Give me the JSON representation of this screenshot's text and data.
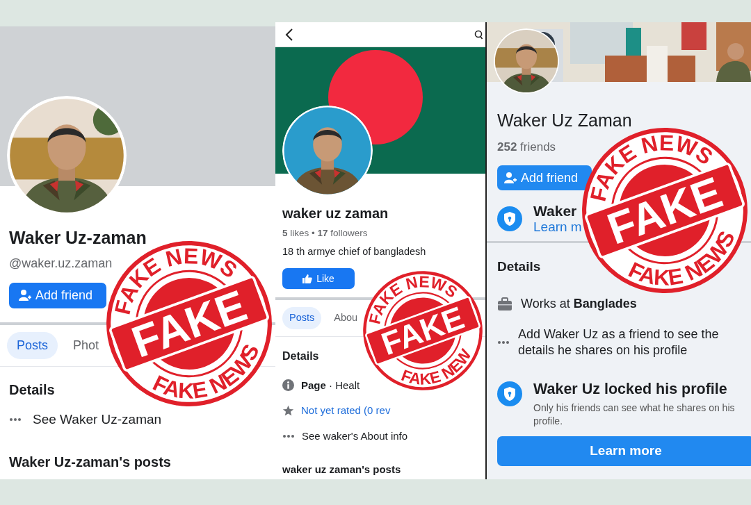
{
  "screenshots": [
    {
      "kind": "profile_grey",
      "name": "Waker Uz-zaman",
      "handle": "@waker.uz.zaman",
      "add_friend": "Add friend",
      "tabs": [
        {
          "label": "Posts",
          "selected": true
        },
        {
          "label": "Phot",
          "selected": false
        }
      ],
      "details_title": "Details",
      "details": [
        {
          "kind": "more",
          "text": "See Waker Uz-zaman"
        }
      ],
      "posts_title": "Waker Uz-zaman's posts",
      "stamp": {
        "top": "FAKE NEWS",
        "middle": "FAKE",
        "bottom": "FAKE NEWS"
      }
    },
    {
      "kind": "page_flag",
      "name": "waker uz zaman",
      "stats": "**5** likes  •  **17** followers",
      "bio": "18 th armye chief of bangladesh",
      "like": "Like",
      "tabs": [
        {
          "label": "Posts",
          "selected": true
        },
        {
          "label": "Abou",
          "selected": false
        }
      ],
      "details_title": "Details",
      "details": [
        {
          "kind": "info",
          "text": "**Page** · Healt"
        },
        {
          "kind": "star",
          "text": "Not yet rated (0 rev"
        },
        {
          "kind": "more",
          "text": "See waker's About info"
        }
      ],
      "posts_title": "waker uz zaman's posts",
      "stamp": {
        "top": "FAKE NEWS",
        "middle": "FAKE",
        "bottom": "FAKE NEW"
      }
    },
    {
      "kind": "profile_locked",
      "name": "Waker Uz Zaman",
      "friends": "**252** friends",
      "add_friend": "Add friend",
      "lock_notice": {
        "title": "Waker",
        "link": "Learn m"
      },
      "details_title": "Details",
      "details": [
        {
          "kind": "work",
          "text": "Works at **Banglades**"
        },
        {
          "kind": "more",
          "text": "Add Waker Uz as a friend to see the details he shares on his profile"
        }
      ],
      "locked": {
        "title": "Waker Uz locked his profile",
        "text": "Only his friends can see what he shares on his profile.",
        "button": "Learn more"
      },
      "stamp": {
        "top": "FAKE NEWS",
        "middle": "FAKE",
        "bottom": "FAKE NEWS"
      }
    }
  ]
}
